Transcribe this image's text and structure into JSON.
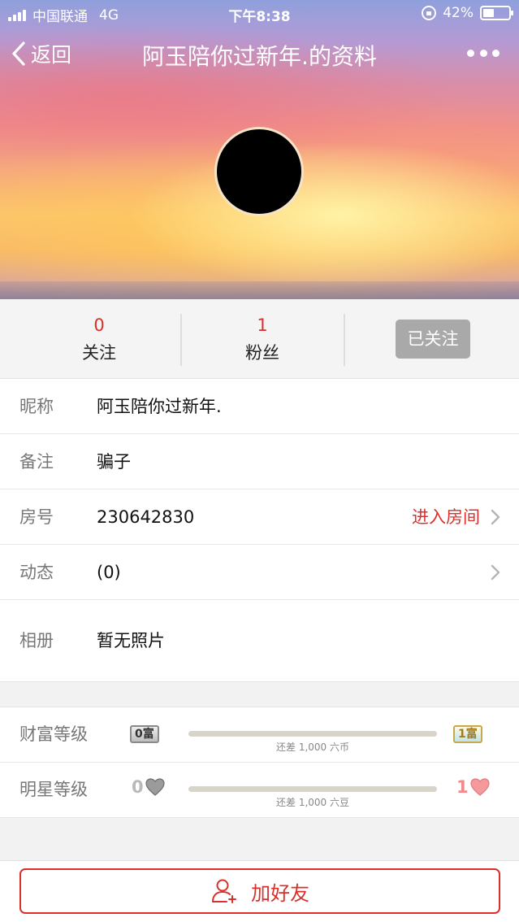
{
  "status_bar": {
    "carrier": "中国联通",
    "network": "4G",
    "time": "下午8:38",
    "battery": "42%",
    "battery_level": 0.42
  },
  "nav": {
    "back_label": "返回",
    "title": "阿玉陪你过新年.的资料"
  },
  "stats": {
    "following_count": "0",
    "following_label": "关注",
    "fans_count": "1",
    "fans_label": "粉丝",
    "follow_button": "已关注"
  },
  "profile": {
    "nickname_label": "昵称",
    "nickname": "阿玉陪你过新年.",
    "remark_label": "备注",
    "remark": "骗子",
    "room_label": "房号",
    "room": "230642830",
    "enter_room": "进入房间",
    "moments_label": "动态",
    "moments": "(0)",
    "album_label": "相册",
    "album": "暂无照片"
  },
  "levels": {
    "wealth_label": "财富等级",
    "wealth_current_badge": "0富",
    "wealth_next_badge": "1富",
    "wealth_hint": "还差 1,000 六币",
    "wealth_progress": 0,
    "star_label": "明星等级",
    "star_current": "0",
    "star_next": "1",
    "star_hint": "还差 1,000 六豆",
    "star_progress": 0
  },
  "actions": {
    "add_friend": "加好友"
  },
  "colors": {
    "accent_red": "#d9302c",
    "gray_button": "#a9a9a9"
  }
}
